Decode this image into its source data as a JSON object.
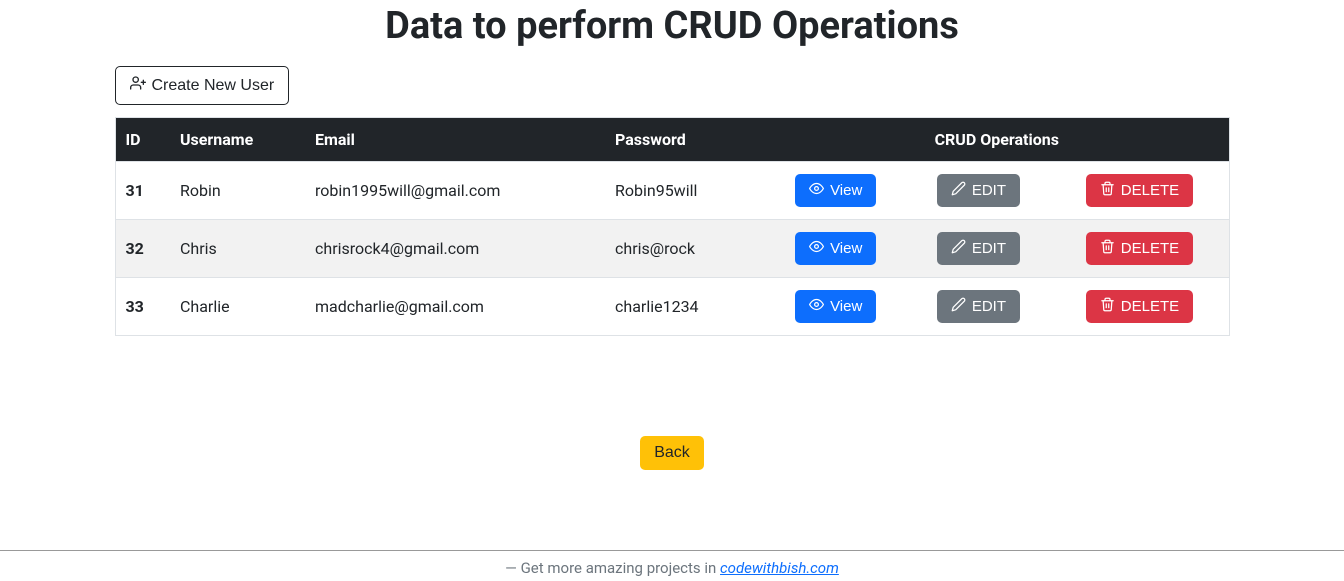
{
  "title": "Data to perform CRUD Operations",
  "create_button": "Create New User",
  "headers": {
    "id": "ID",
    "username": "Username",
    "email": "Email",
    "password": "Password",
    "ops": "CRUD Operations"
  },
  "rows": [
    {
      "id": "31",
      "username": "Robin",
      "email": "robin1995will@gmail.com",
      "password": "Robin95will"
    },
    {
      "id": "32",
      "username": "Chris",
      "email": "chrisrock4@gmail.com",
      "password": "chris@rock"
    },
    {
      "id": "33",
      "username": "Charlie",
      "email": "madcharlie@gmail.com",
      "password": "charlie1234"
    }
  ],
  "buttons": {
    "view": "View",
    "edit": "EDIT",
    "delete": "DELETE",
    "back": "Back"
  },
  "footer": {
    "prefix": "— Get more amazing projects in ",
    "link_text": "codewithbish.com"
  }
}
